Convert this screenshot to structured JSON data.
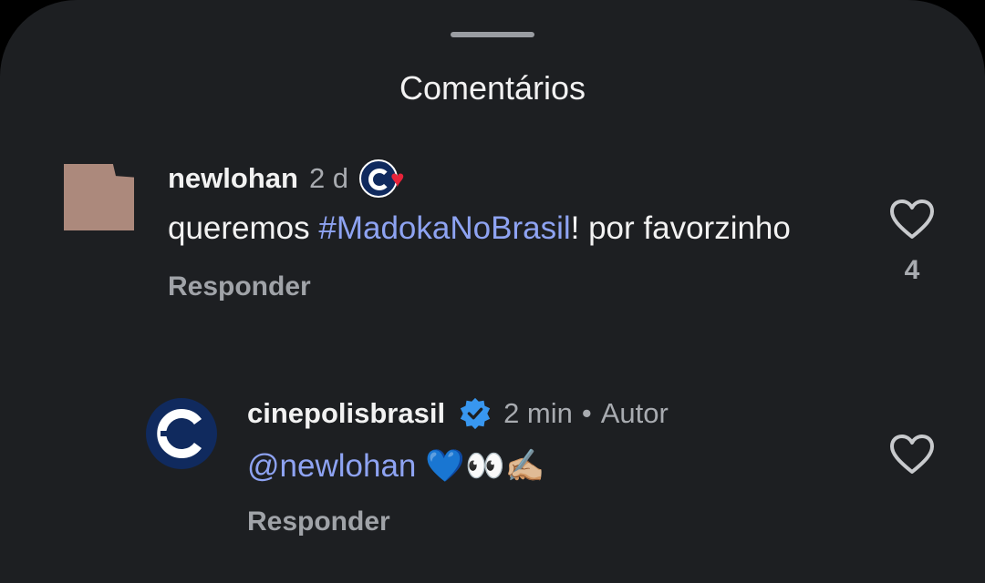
{
  "header": {
    "title": "Comentários"
  },
  "comments": [
    {
      "username": "newlohan",
      "time": "2 d",
      "text_before": "queremos ",
      "hashtag": "#MadokaNoBrasil",
      "text_after": "! por favorzinho",
      "reply_label": "Responder",
      "like_count": "4",
      "liked_by_author_icon": "heart-icon",
      "avatar_color": "#b89284"
    },
    {
      "username": "cinepolisbrasil",
      "verified": true,
      "time": "2 min",
      "separator": "•",
      "author_label": "Autor",
      "mention": "@newlohan",
      "emojis": "💙👀✍🏼",
      "reply_label": "Responder",
      "avatar_color": "#102a5e"
    }
  ],
  "colors": {
    "background": "#1d1f22",
    "link": "#8ea3f2",
    "muted": "#a8abb0",
    "verified_blue": "#3897f0",
    "heart_red": "#e8233a"
  }
}
